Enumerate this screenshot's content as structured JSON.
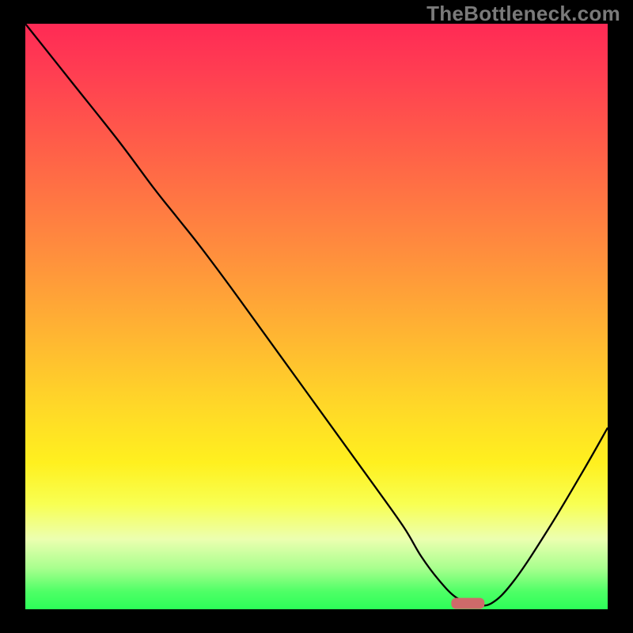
{
  "watermark": "TheBottleneck.com",
  "chart_data": {
    "type": "line",
    "title": "",
    "xlabel": "",
    "ylabel": "",
    "xlim": [
      0,
      100
    ],
    "ylim": [
      0,
      100
    ],
    "x": [
      0,
      8,
      16,
      22,
      26,
      30,
      36,
      44,
      52,
      60,
      65,
      68,
      71,
      74,
      77,
      80,
      84,
      90,
      96,
      100
    ],
    "values": [
      100,
      90,
      80,
      72,
      67,
      62,
      54,
      43,
      32,
      21,
      14,
      9,
      5,
      2,
      1,
      1,
      5,
      14,
      24,
      31
    ],
    "marker": {
      "x": 76,
      "y": 1,
      "color": "#ce6a6a"
    },
    "gradient_legend_note": "background encodes severity: red=100 (top) → green=0 (bottom)"
  }
}
